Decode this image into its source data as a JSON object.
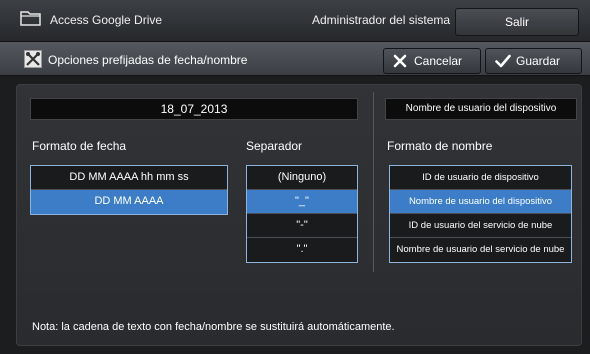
{
  "topbar": {
    "app_title": "Access Google Drive",
    "app_icon": "folder-icon",
    "user": "Administrador del sistema",
    "logout_label": "Salir"
  },
  "titlebar": {
    "title": "Opciones prefijadas de fecha/nombre",
    "title_icon": "settings-tools-icon",
    "cancel_label": "Cancelar",
    "cancel_icon": "close-icon",
    "save_label": "Guardar",
    "save_icon": "checkmark-icon"
  },
  "date_preview": "18_07_2013",
  "name_preview": "Nombre de usuario del dispositivo",
  "date_format": {
    "label": "Formato de fecha",
    "options": [
      "DD MM AAAA hh mm ss",
      "DD MM AAAA"
    ],
    "selected_index": 1
  },
  "separator": {
    "label": "Separador",
    "options": [
      "(Ninguno)",
      "\"_\"",
      "\"-\"",
      "\".\""
    ],
    "selected_index": 1
  },
  "name_format": {
    "label": "Formato de nombre",
    "options": [
      "ID de usuario de dispositivo",
      "Nombre de usuario del dispositivo",
      "ID de usuario del servicio de nube",
      "Nombre de usuario del servicio de nube"
    ],
    "selected_index": 1
  },
  "note": "Nota: la cadena de texto con fecha/nombre se sustituirá automáticamente.",
  "colors": {
    "selected": "#3d7dc8",
    "highlight_border": "#8fb4dc",
    "background": "#1c1d1f"
  }
}
